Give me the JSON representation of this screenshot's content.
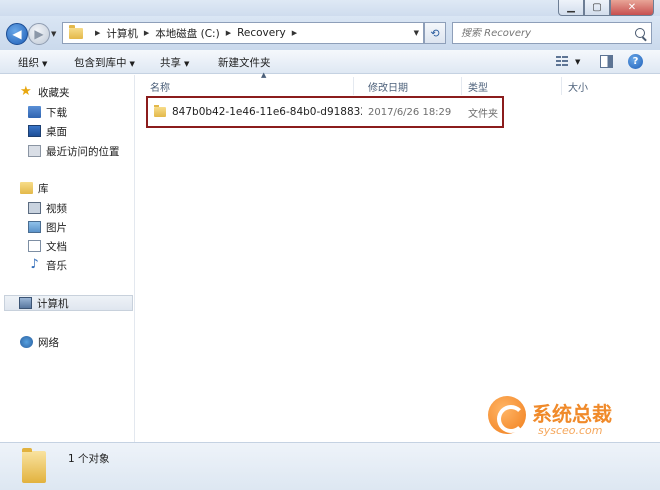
{
  "window": {
    "min_glyph": "▁",
    "max_glyph": "▢",
    "close_glyph": "✕"
  },
  "address": {
    "back_glyph": "◀",
    "forward_glyph": "▶",
    "crumbs": [
      "计算机",
      "本地磁盘 (C:)",
      "Recovery"
    ],
    "refresh_glyph": "⟲"
  },
  "search": {
    "placeholder": "搜索 Recovery"
  },
  "toolbar": {
    "organize": "组织",
    "include_in_library": "包含到库中",
    "share": "共享",
    "new_folder": "新建文件夹",
    "help_glyph": "?"
  },
  "sidebar": {
    "favorites": "收藏夹",
    "downloads": "下载",
    "desktop": "桌面",
    "recent": "最近访问的位置",
    "libraries": "库",
    "videos": "视频",
    "pictures": "图片",
    "documents": "文档",
    "music": "音乐",
    "computer": "计算机",
    "network": "网络"
  },
  "columns": {
    "name": "名称",
    "date": "修改日期",
    "type": "类型",
    "size": "大小"
  },
  "files": [
    {
      "name": "847b0b42-1e46-11e6-84b0-d918832...",
      "date": "2017/6/26 18:29",
      "type": "文件夹"
    }
  ],
  "details": {
    "count_text": "1 个对象"
  },
  "watermark": {
    "cn": "系统总裁",
    "en": "sysceo.com"
  },
  "colors": {
    "highlight_border": "#8b1c1c",
    "watermark_orange": "#f08a2a"
  }
}
